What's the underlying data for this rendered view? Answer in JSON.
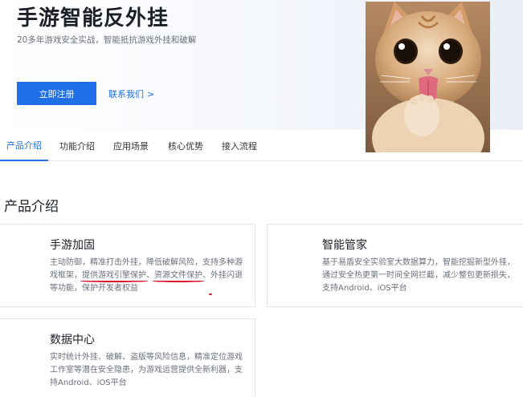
{
  "hero": {
    "title": "手游智能反外挂",
    "subtitle": "20多年游戏安全实战，智能抵抗游戏外挂和破解",
    "register_label": "立即注册",
    "contact_label": "联系我们",
    "contact_arrow": ">"
  },
  "tabs": [
    {
      "label": "产品介绍",
      "active": true
    },
    {
      "label": "功能介绍",
      "active": false
    },
    {
      "label": "应用场景",
      "active": false
    },
    {
      "label": "核心优势",
      "active": false
    },
    {
      "label": "接入流程",
      "active": false
    }
  ],
  "section": {
    "title": "产品介绍"
  },
  "cards": {
    "mobile": {
      "title": "手游加固",
      "desc_part1": "主动防御，精准打击外挂，降低破解风险，支持多种游戏框架，",
      "hl1": "提供游戏引擎保护",
      "sep1": "、",
      "hl2": "资源文件保护",
      "sep2": "、",
      "hl3": "外挂闪退等功能",
      "desc_part2": "，保护开发者权益"
    },
    "manager": {
      "title": "智能管家",
      "desc": "基于易盾安全实验室大数据算力，智能挖掘新型外挂，通过安全热更第一时间全网拦截，减少整包更新损失，支持Android、iOS平台"
    },
    "data_center": {
      "title": "数据中心",
      "desc": "实时统计外挂、破解、盗版等风险信息，精准定位游戏工作室等潜在安全隐患，为游戏运营提供全新利器，支持Android、iOS平台"
    }
  },
  "colors": {
    "accent": "#1e6fe8",
    "annotation": "#d9142b"
  }
}
